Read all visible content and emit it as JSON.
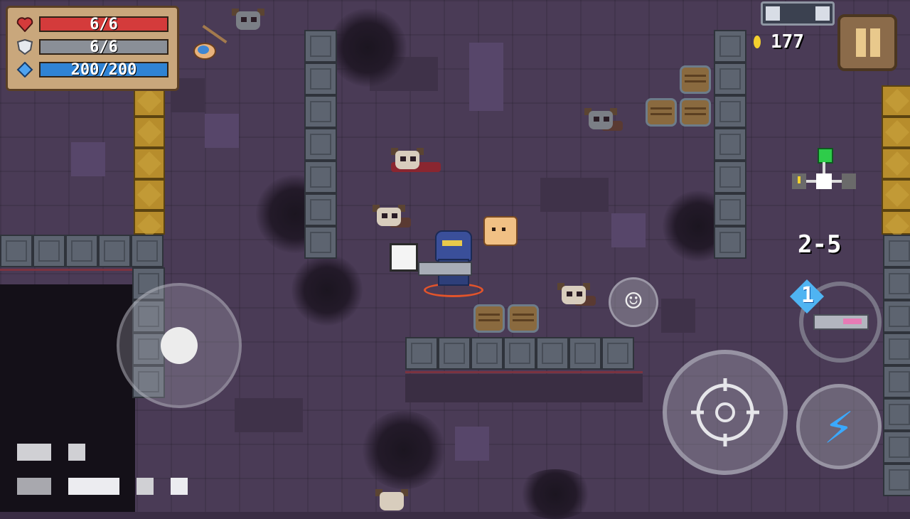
{
  "hud": {
    "health": "6/6",
    "armor": "6/6",
    "energy": "200/200",
    "health_pct": 1.0,
    "armor_pct": 1.0,
    "energy_pct": 1.0,
    "coins": "177",
    "level": "2-5",
    "weapon_slot_count": "1"
  },
  "icons": {
    "health": "heart-icon",
    "armor": "shield-icon",
    "energy": "diamond-icon",
    "pause": "pause-icon",
    "emote": "smiley-icon",
    "fire": "crosshair-icon",
    "skill": "lightning-icon",
    "swap": "weapon-swap-icon",
    "coin": "coin-icon",
    "buff": "buff-icon"
  },
  "colors": {
    "health_bar": "#d43b3b",
    "armor_bar": "#8a8f97",
    "energy_bar": "#2f83d4",
    "skill": "#3aa9ff",
    "minimap_exit": "#2ecc4a"
  }
}
